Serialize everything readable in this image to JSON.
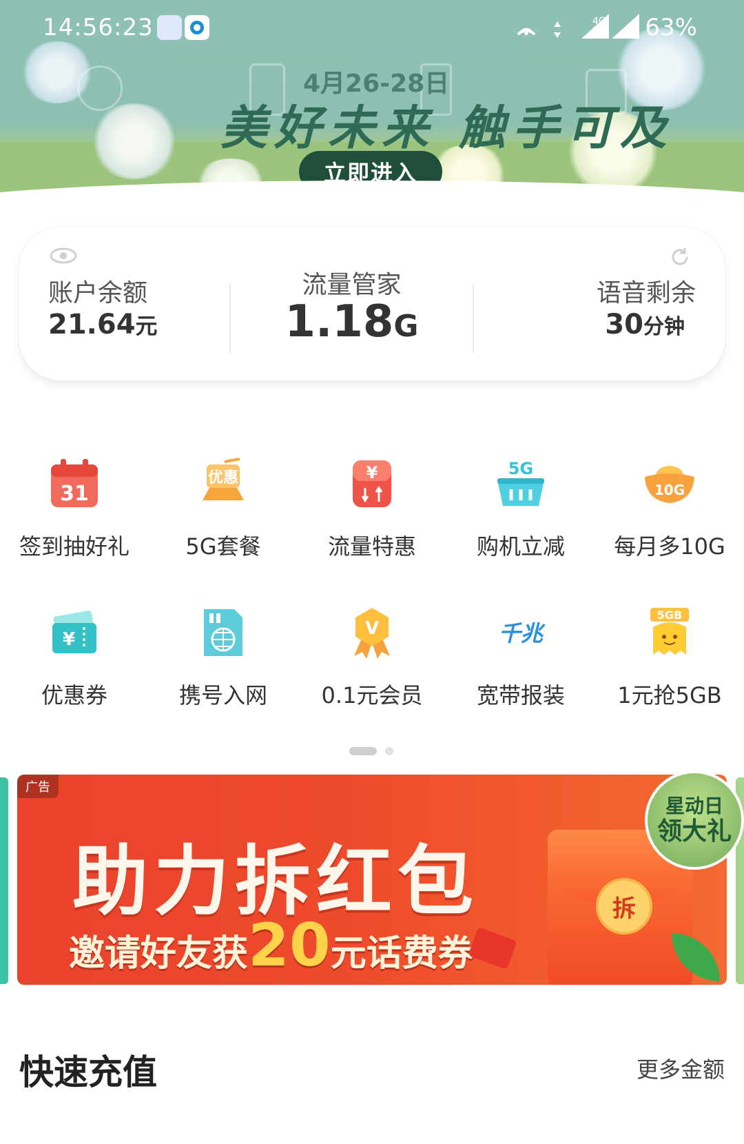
{
  "status_bar": {
    "time": "14:56:23",
    "network": "4G 1X",
    "battery": "63%",
    "icons": [
      "app-icon",
      "china-mobile-icon",
      "hotspot-icon",
      "data-arrows-icon",
      "signal-icon",
      "signal-icon-2"
    ]
  },
  "hero": {
    "date": "4月26-28日",
    "slogan": "美好未来 触手可及",
    "button_label": "立即进入"
  },
  "account": {
    "balance_label": "账户余额",
    "balance_value": "21.64",
    "balance_unit": "元",
    "data_label": "流量管家",
    "data_value": "1.18",
    "data_unit": "G",
    "voice_label": "语音剩余",
    "voice_value": "30",
    "voice_unit": "分钟"
  },
  "menu": {
    "items": [
      {
        "label": "签到抽好礼",
        "icon": "calendar-icon"
      },
      {
        "label": "5G套餐",
        "icon": "5g-package-icon"
      },
      {
        "label": "流量特惠",
        "icon": "data-discount-icon"
      },
      {
        "label": "购机立减",
        "icon": "shopping-basket-icon"
      },
      {
        "label": "每月多10G",
        "icon": "gold-ingot-icon"
      },
      {
        "label": "优惠券",
        "icon": "coupon-icon"
      },
      {
        "label": "携号入网",
        "icon": "sim-globe-icon"
      },
      {
        "label": "0.1元会员",
        "icon": "vip-medal-icon"
      },
      {
        "label": "宽带报装",
        "icon": "broadband-icon"
      },
      {
        "label": "1元抢5GB",
        "icon": "5gb-mascot-icon"
      }
    ],
    "icon_text": {
      "calendar": "31",
      "package": "优惠",
      "data": "¥",
      "basket": "5G",
      "ingot": "10G",
      "coupon": "¥",
      "vip": "V",
      "broadband": "千兆",
      "mascot": "5GB"
    }
  },
  "pager": {
    "pages": 2,
    "active": 1
  },
  "ad": {
    "tag": "广告",
    "title": "助力拆红包",
    "subtitle_pre": "邀请好友获",
    "subtitle_amount": "20",
    "subtitle_post": "元话费券",
    "seal": "拆",
    "badge_line1": "星动日",
    "badge_line2": "领大礼"
  },
  "quick_recharge": {
    "title": "快速充值",
    "more": "更多金额"
  },
  "colors": {
    "accent_green": "#1f4e3a",
    "hero_teal": "#8ec0b3",
    "ad_red": "#ee4a2c",
    "icon_red": "#f2584a",
    "icon_orange": "#f7a23c",
    "icon_cyan": "#37c6d8"
  }
}
